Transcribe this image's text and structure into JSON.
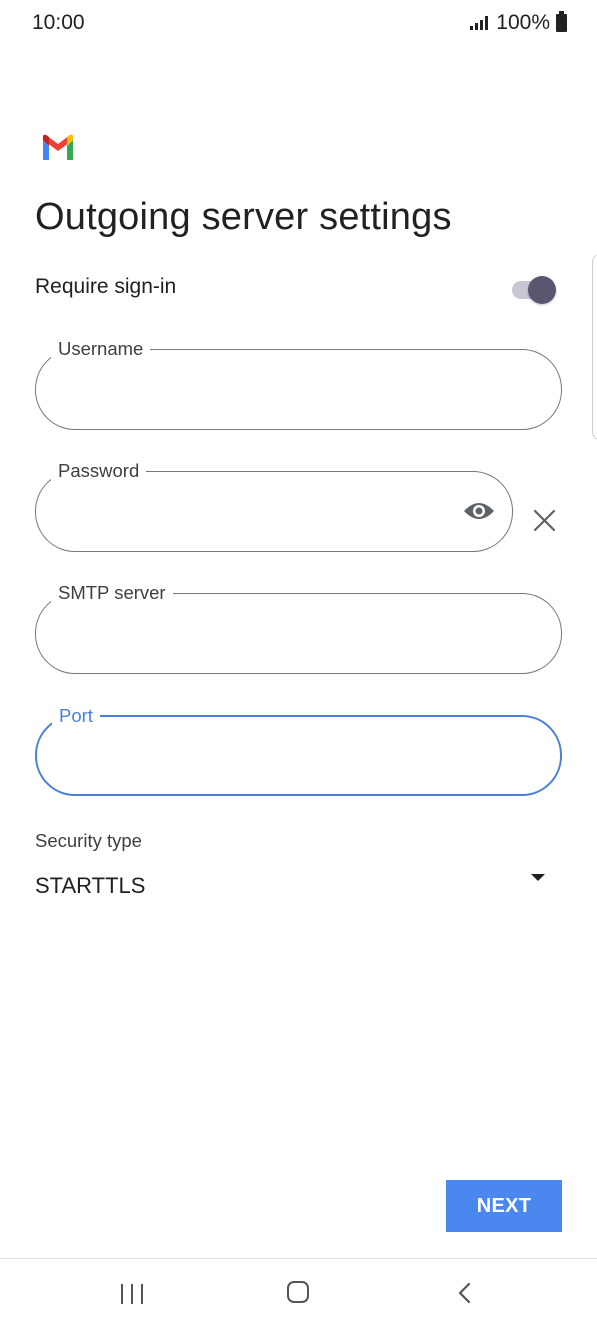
{
  "status_bar": {
    "time": "10:00",
    "battery": "100%",
    "signal_icon": "signal-icon",
    "battery_icon": "battery-icon"
  },
  "app": {
    "logo_icon": "gmail-logo-icon"
  },
  "page": {
    "title": "Outgoing server settings"
  },
  "require_signin": {
    "label": "Require sign-in",
    "enabled": true
  },
  "fields": {
    "username": {
      "label": "Username",
      "value": ""
    },
    "password": {
      "label": "Password",
      "value": "",
      "toggle_icon": "eye-icon",
      "clear_icon": "close-icon"
    },
    "smtp_server": {
      "label": "SMTP server",
      "value": ""
    },
    "port": {
      "label": "Port",
      "value": "",
      "focused": true
    }
  },
  "security": {
    "label": "Security type",
    "value": "STARTTLS"
  },
  "actions": {
    "next_label": "NEXT"
  },
  "nav": {
    "recents_icon": "recents-icon",
    "home_icon": "home-icon",
    "back_icon": "back-icon"
  },
  "colors": {
    "accent": "#4a88f0",
    "focus": "#4a80d8",
    "toggle_thumb": "#5b5570"
  }
}
